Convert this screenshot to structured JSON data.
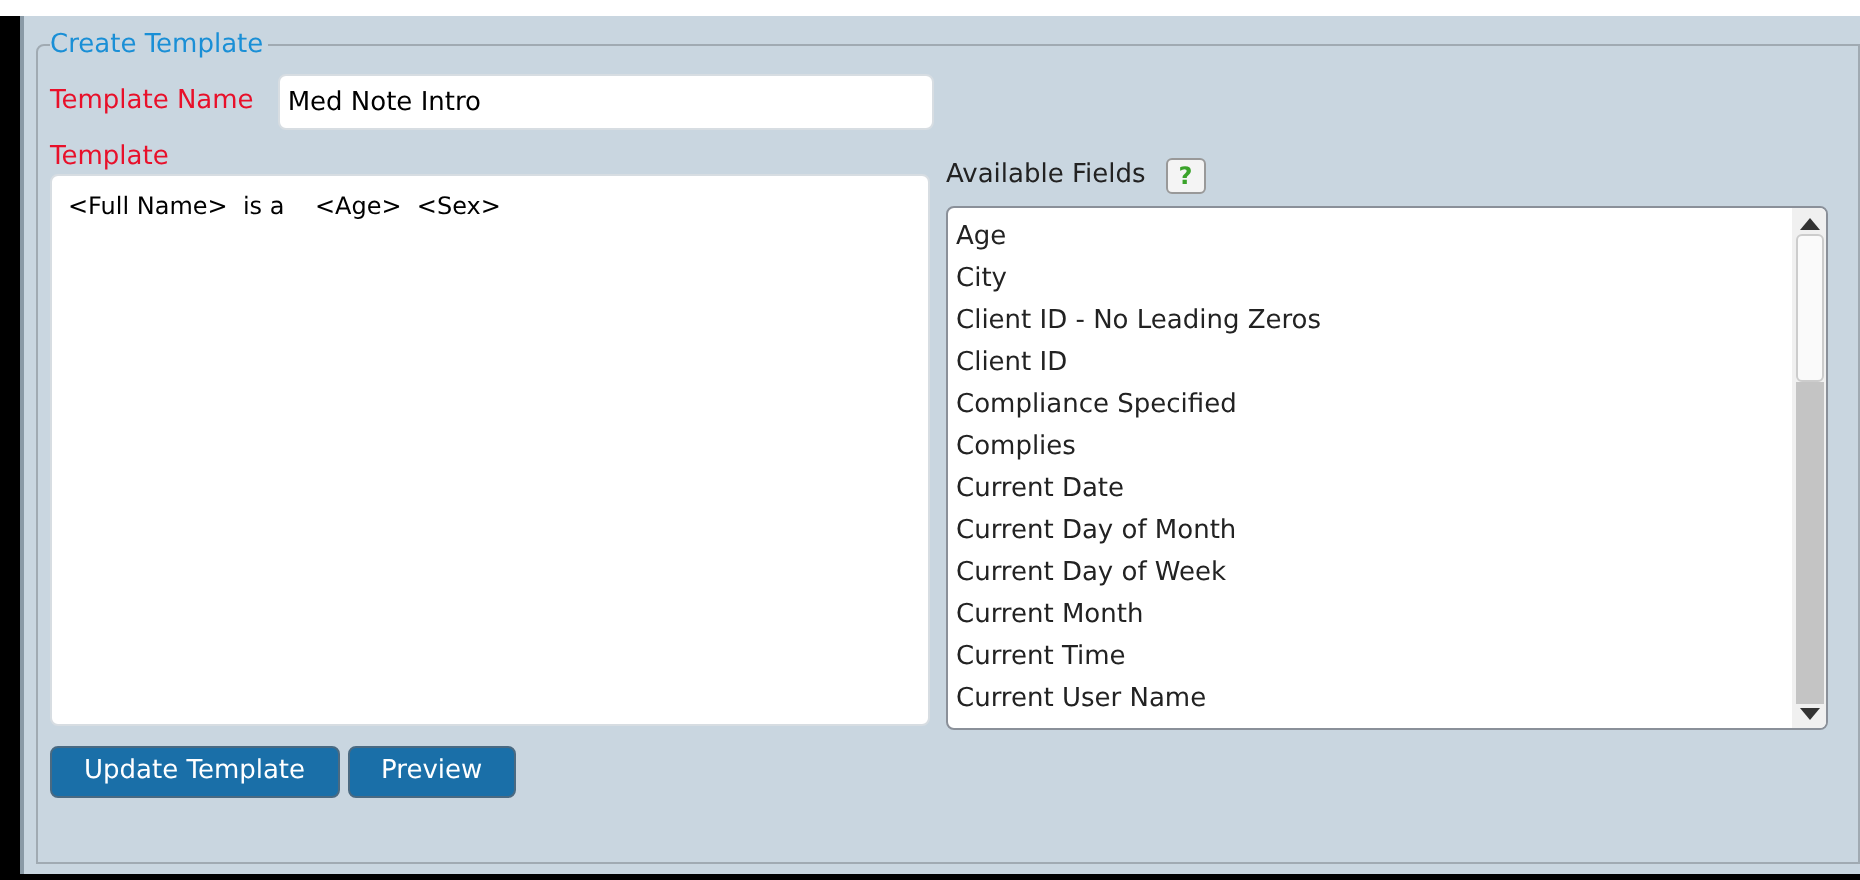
{
  "legend": "Create Template",
  "template_name": {
    "label": "Template Name",
    "value": "Med Note Intro"
  },
  "template": {
    "label": "Template",
    "value": "<Full Name>  is a    <Age>  <Sex>"
  },
  "available_fields": {
    "label": "Available Fields",
    "help": "?",
    "items": [
      "Age",
      "City",
      "Client ID -  No Leading Zeros",
      "Client ID",
      "Compliance Specified",
      "Complies",
      "Current Date",
      "Current Day of Month",
      "Current Day of Week",
      "Current Month",
      "Current Time",
      "Current User Name"
    ]
  },
  "buttons": [
    "Update Template",
    "Preview"
  ]
}
